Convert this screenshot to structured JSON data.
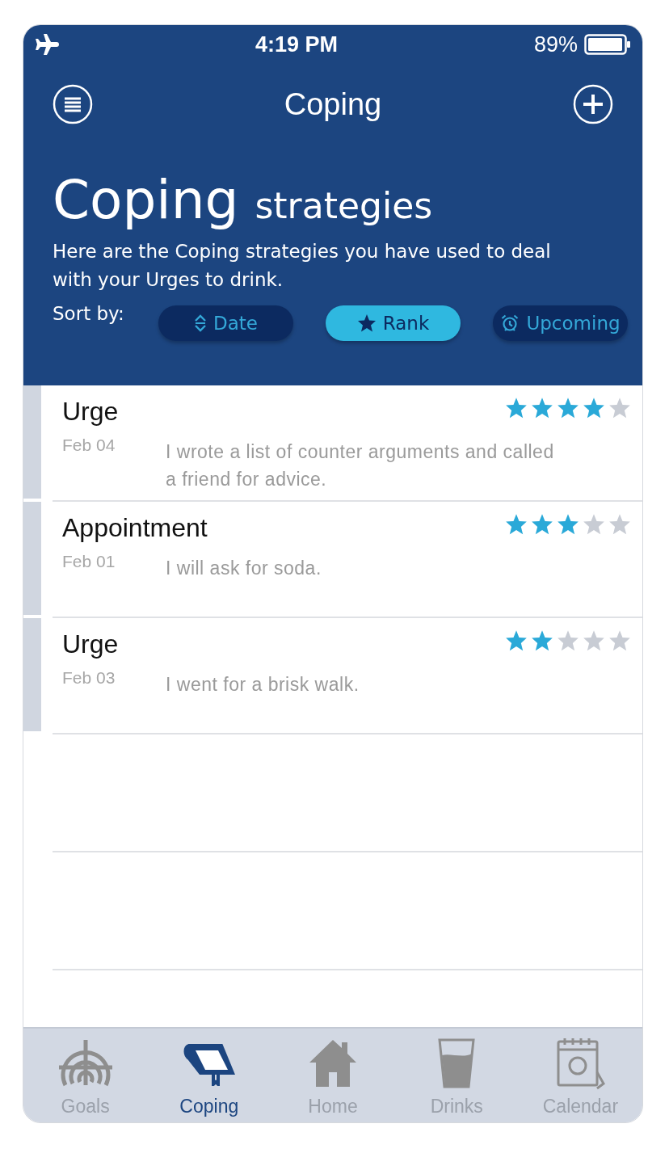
{
  "status_bar": {
    "time": "4:19 PM",
    "battery": "89%"
  },
  "nav": {
    "title": "Coping"
  },
  "header": {
    "title_big": "Coping",
    "title_small": "strategies",
    "description": "Here are the Coping strategies you have used to deal with your Urges to drink."
  },
  "sort": {
    "label": "Sort by:",
    "options": [
      {
        "label": "Date",
        "kind": "arrows",
        "selected": false
      },
      {
        "label": "Rank",
        "kind": "star",
        "selected": true
      },
      {
        "label": "Upcoming",
        "kind": "alarm",
        "selected": false
      }
    ]
  },
  "entries": [
    {
      "title": "Urge",
      "date": "Feb 04",
      "text": "I wrote a list of counter arguments and called a friend for advice.",
      "stars": 4
    },
    {
      "title": "Appointment",
      "date": "Feb 01",
      "text": "I will ask for soda.",
      "stars": 3
    },
    {
      "title": "Urge",
      "date": "Feb 03",
      "text": "I went for a brisk walk.",
      "stars": 2
    }
  ],
  "tabs": [
    {
      "label": "Goals",
      "kind": "target",
      "selected": false
    },
    {
      "label": "Coping",
      "kind": "book",
      "selected": true
    },
    {
      "label": "Home",
      "kind": "house",
      "selected": false
    },
    {
      "label": "Drinks",
      "kind": "glass",
      "selected": false
    },
    {
      "label": "Calendar",
      "kind": "calendar",
      "selected": false
    }
  ]
}
